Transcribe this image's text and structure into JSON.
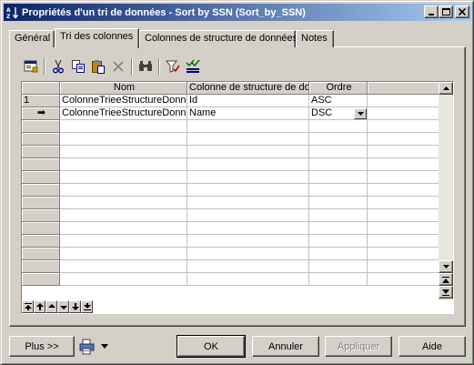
{
  "window": {
    "title": "Propriétés d'un tri de données - Sort by SSN (Sort_by_SSN)"
  },
  "titlebar_buttons": {
    "minimize": "minimize-icon",
    "maximize": "maximize-icon",
    "close": "close-icon"
  },
  "tabs": [
    {
      "label": "Général",
      "active": false
    },
    {
      "label": "Tri des colonnes",
      "active": true
    },
    {
      "label": "Colonnes de structure de données",
      "active": false
    },
    {
      "label": "Notes",
      "active": false
    }
  ],
  "toolbar": {
    "icons": [
      "properties-icon",
      "cut-icon",
      "copy-icon",
      "paste-icon",
      "delete-icon",
      "find-icon",
      "filter-icon",
      "customize-columns-icon"
    ]
  },
  "grid": {
    "columns": [
      "Nom",
      "Colonne de structure de do",
      "Ordre"
    ],
    "rows": [
      {
        "marker": "1",
        "nom": "ColonneTrieeStructureDonn",
        "colonne": "Id",
        "ordre": "ASC"
      },
      {
        "marker": "➡",
        "nom": "ColonneTrieeStructureDonn",
        "colonne": "Name",
        "ordre": "DSC"
      }
    ],
    "empty_rows": 13,
    "scrollbar_icons": [
      "scroll-up-icon",
      "scroll-down-icon",
      "scroll-top-icon",
      "scroll-bottom-icon"
    ],
    "nav_icons": [
      "move-first-icon",
      "move-up-page-icon",
      "move-up-icon",
      "move-down-icon",
      "move-down-page-icon",
      "move-last-icon"
    ]
  },
  "buttons": {
    "more": "Plus >>",
    "ok": "OK",
    "cancel": "Annuler",
    "apply": "Appliquer",
    "help": "Aide"
  },
  "colors": {
    "title_start": "#0a246a",
    "title_end": "#a6caf0",
    "face": "#d4d0c8"
  }
}
